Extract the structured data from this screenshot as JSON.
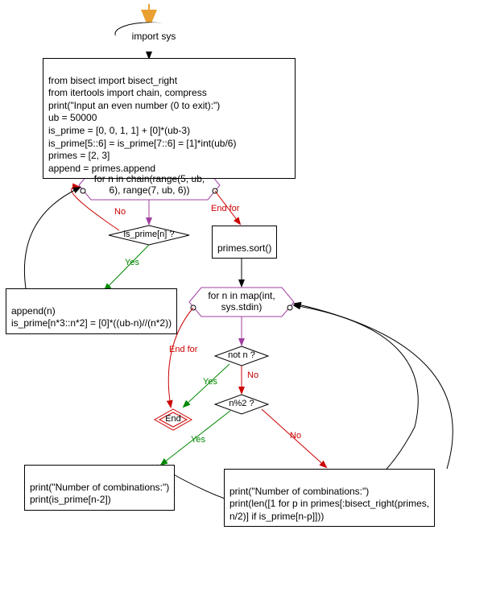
{
  "nodes": {
    "start": "import sys",
    "init_block": "from bisect import bisect_right\nfrom itertools import chain, compress\nprint(\"Input an even number (0 to exit):\")\nub = 50000\nis_prime = [0, 0, 1, 1] + [0]*(ub-3)\nis_prime[5::6] = is_prime[7::6] = [1]*int(ub/6)\nprimes = [2, 3]\nappend = primes.append",
    "loop1": "for n in chain(range(5,\nub, 6), range(7, ub, 6))",
    "is_prime_check": "is_prime[n] ?",
    "sort": "primes.sort()",
    "append_block": "append(n)\nis_prime[n*3::n*2] = [0]*((ub-n)//(n*2))",
    "loop2": "for n in map(int,\nsys.stdin)",
    "not_n": "not n ?",
    "end": "End",
    "n_mod_2": "n%2 ?",
    "print_left": "print(\"Number of combinations:\")\nprint(is_prime[n-2])",
    "print_right": "print(\"Number of combinations:\")\nprint(len([1 for p in primes[:bisect_right(primes,\nn/2)] if is_prime[n-p]]))"
  },
  "edge_labels": {
    "no": "No",
    "yes": "Yes",
    "end_for": "End for"
  }
}
